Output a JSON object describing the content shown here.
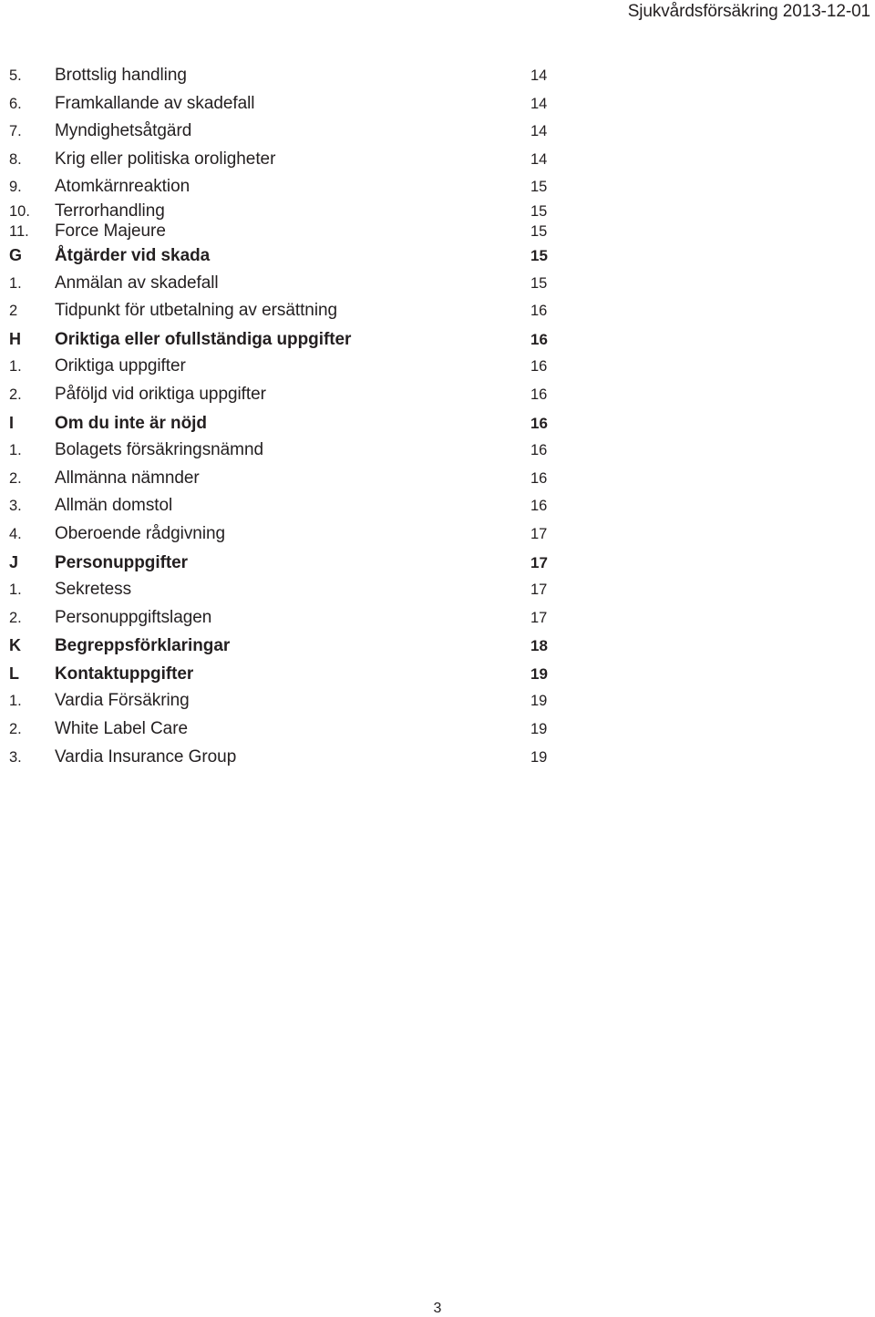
{
  "header": {
    "title": "Sjukvårdsförsäkring 2013-12-01"
  },
  "footer": {
    "page_number": "3"
  },
  "colors": {
    "text": "#231f20",
    "background": "#ffffff"
  },
  "toc": {
    "rows": [
      {
        "num": "5.",
        "title": "Brottslig handling",
        "page": "14",
        "bold": false,
        "tight": false
      },
      {
        "num": "6.",
        "title": "Framkallande av skadefall",
        "page": "14",
        "bold": false,
        "tight": false
      },
      {
        "num": "7.",
        "title": "Myndighetsåtgärd",
        "page": "14",
        "bold": false,
        "tight": false
      },
      {
        "num": "8.",
        "title": "Krig eller politiska oroligheter",
        "page": "14",
        "bold": false,
        "tight": false
      },
      {
        "num": "9.",
        "title": "Atomkärnreaktion",
        "page": "15",
        "bold": false,
        "tight": false
      },
      {
        "num": "10.",
        "title": "Terrorhandling",
        "page": "15",
        "bold": false,
        "tight": true
      },
      {
        "num": "11.",
        "title": "Force Majeure",
        "page": "15",
        "bold": false,
        "tight": true
      },
      {
        "num": "G",
        "title": "Åtgärder vid skada",
        "page": "15",
        "bold": true,
        "tight": false
      },
      {
        "num": "1.",
        "title": "Anmälan av skadefall",
        "page": "15",
        "bold": false,
        "tight": false
      },
      {
        "num": "2",
        "title": "Tidpunkt för utbetalning av ersättning",
        "page": "16",
        "bold": false,
        "tight": false
      },
      {
        "num": "H",
        "title": "Oriktiga eller ofullständiga uppgifter",
        "page": "16",
        "bold": true,
        "tight": false
      },
      {
        "num": "1.",
        "title": "Oriktiga uppgifter",
        "page": "16",
        "bold": false,
        "tight": false
      },
      {
        "num": "2.",
        "title": "Påföljd vid oriktiga uppgifter",
        "page": "16",
        "bold": false,
        "tight": false
      },
      {
        "num": "I",
        "title": "Om du inte är nöjd",
        "page": "16",
        "bold": true,
        "tight": false
      },
      {
        "num": "1.",
        "title": "Bolagets försäkringsnämnd",
        "page": "16",
        "bold": false,
        "tight": false
      },
      {
        "num": "2.",
        "title": "Allmänna nämnder",
        "page": "16",
        "bold": false,
        "tight": false
      },
      {
        "num": "3.",
        "title": "Allmän domstol",
        "page": "16",
        "bold": false,
        "tight": false
      },
      {
        "num": "4.",
        "title": "Oberoende rådgivning",
        "page": "17",
        "bold": false,
        "tight": false
      },
      {
        "num": "J",
        "title": "Personuppgifter",
        "page": "17",
        "bold": true,
        "tight": false
      },
      {
        "num": "1.",
        "title": "Sekretess",
        "page": "17",
        "bold": false,
        "tight": false
      },
      {
        "num": "2.",
        "title": "Personuppgiftslagen",
        "page": "17",
        "bold": false,
        "tight": false
      },
      {
        "num": "K",
        "title": "Begreppsförklaringar",
        "page": "18",
        "bold": true,
        "tight": false
      },
      {
        "num": "L",
        "title": "Kontaktuppgifter",
        "page": "19",
        "bold": true,
        "tight": false
      },
      {
        "num": "1.",
        "title": "Vardia Försäkring",
        "page": "19",
        "bold": false,
        "tight": false
      },
      {
        "num": "2.",
        "title": "White Label Care",
        "page": "19",
        "bold": false,
        "tight": false
      },
      {
        "num": "3.",
        "title": "Vardia Insurance Group",
        "page": "19",
        "bold": false,
        "tight": false
      }
    ]
  }
}
